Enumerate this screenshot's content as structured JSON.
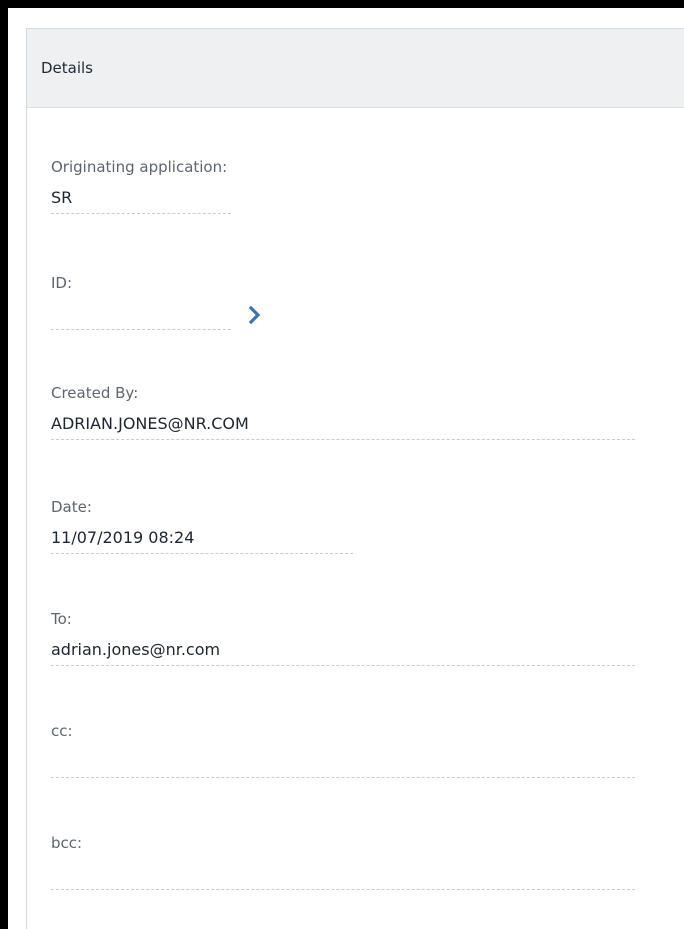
{
  "panel": {
    "title": "Details"
  },
  "fields": {
    "originating_application": {
      "label": "Originating application:",
      "value": "SR"
    },
    "id": {
      "label": "ID:",
      "value": ""
    },
    "created_by": {
      "label": "Created By:",
      "value": "ADRIAN.JONES@NR.COM"
    },
    "date": {
      "label": "Date:",
      "value": "11/07/2019 08:24"
    },
    "to": {
      "label": "To:",
      "value": "adrian.jones@nr.com"
    },
    "cc": {
      "label": "cc:",
      "value": ""
    },
    "bcc": {
      "label": "bcc:",
      "value": ""
    }
  },
  "icons": {
    "id_navigate": "chevron-right-icon"
  },
  "colors": {
    "header_bg": "#eef0f2",
    "chevron": "#3b73b9"
  }
}
